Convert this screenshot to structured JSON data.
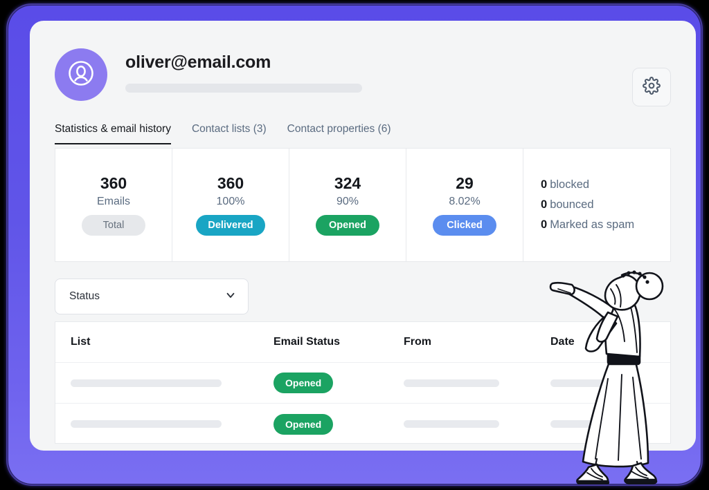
{
  "header": {
    "avatar_icon": "user-circle-icon",
    "email": "oliver@email.com",
    "settings_icon": "gear-icon"
  },
  "tabs": [
    {
      "label": "Statistics & email history",
      "active": true
    },
    {
      "label": "Contact lists (3)",
      "active": false
    },
    {
      "label": "Contact properties (6)",
      "active": false
    }
  ],
  "stats": [
    {
      "value": "360",
      "label": "Emails",
      "badge": "Total",
      "badge_color": "#e6e8eb"
    },
    {
      "value": "360",
      "label": "100%",
      "badge": "Delivered",
      "badge_color": "#19a5c4"
    },
    {
      "value": "324",
      "label": "90%",
      "badge": "Opened",
      "badge_color": "#1ba362"
    },
    {
      "value": "29",
      "label": "8.02%",
      "badge": "Clicked",
      "badge_color": "#5b8def"
    }
  ],
  "side_stats": [
    {
      "count": "0",
      "label": "blocked"
    },
    {
      "count": "0",
      "label": "bounced"
    },
    {
      "count": "0",
      "label": "Marked as spam"
    }
  ],
  "filter": {
    "label": "Status",
    "chevron_icon": "chevron-down-icon"
  },
  "table": {
    "columns": [
      "List",
      "Email Status",
      "From",
      "Date"
    ],
    "rows": [
      {
        "status": "Opened"
      },
      {
        "status": "Opened"
      }
    ]
  },
  "illustration": {
    "name": "woman-pointing-illustration"
  },
  "theme": {
    "frame": "#6055e8",
    "screen_bg": "#f4f5f6",
    "accent_purple": "#8c7bf0",
    "green": "#1ba362",
    "teal": "#19a5c4",
    "blue": "#5b8def"
  }
}
